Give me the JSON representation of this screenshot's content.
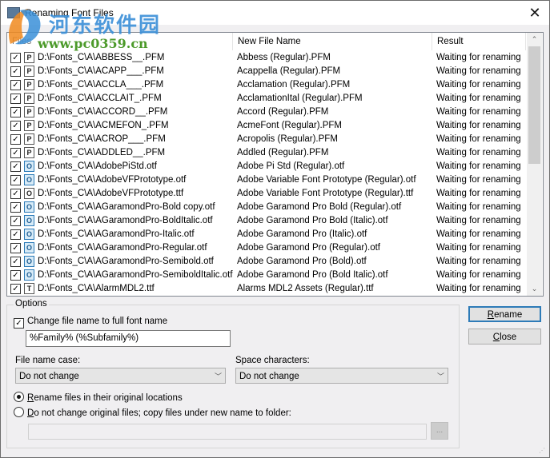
{
  "window": {
    "title": "Renaming Font Files",
    "close_glyph": "✕",
    "title_icon": "app-icon"
  },
  "watermark": {
    "text_cn": "河东软件园",
    "url": "www.pc0359.cn"
  },
  "list": {
    "columns": [
      "Files",
      "New File Name",
      "Result"
    ],
    "rows": [
      {
        "checked": true,
        "type": "P",
        "type_class": "pfm",
        "file": "D:\\Fonts_C\\A\\ABBESS__.PFM",
        "new_name": "Abbess (Regular).PFM",
        "result": "Waiting for renaming"
      },
      {
        "checked": true,
        "type": "P",
        "type_class": "pfm",
        "file": "D:\\Fonts_C\\A\\ACAPP___.PFM",
        "new_name": "Acappella (Regular).PFM",
        "result": "Waiting for renaming"
      },
      {
        "checked": true,
        "type": "P",
        "type_class": "pfm",
        "file": "D:\\Fonts_C\\A\\ACCLA___.PFM",
        "new_name": "Acclamation (Regular).PFM",
        "result": "Waiting for renaming"
      },
      {
        "checked": true,
        "type": "P",
        "type_class": "pfm",
        "file": "D:\\Fonts_C\\A\\ACCLAIT_.PFM",
        "new_name": "AcclamationItal (Regular).PFM",
        "result": "Waiting for renaming"
      },
      {
        "checked": true,
        "type": "P",
        "type_class": "pfm",
        "file": "D:\\Fonts_C\\A\\ACCORD__.PFM",
        "new_name": "Accord (Regular).PFM",
        "result": "Waiting for renaming"
      },
      {
        "checked": true,
        "type": "P",
        "type_class": "pfm",
        "file": "D:\\Fonts_C\\A\\ACMEFON_.PFM",
        "new_name": "AcmeFont (Regular).PFM",
        "result": "Waiting for renaming"
      },
      {
        "checked": true,
        "type": "P",
        "type_class": "pfm",
        "file": "D:\\Fonts_C\\A\\ACROP___.PFM",
        "new_name": "Acropolis (Regular).PFM",
        "result": "Waiting for renaming"
      },
      {
        "checked": true,
        "type": "P",
        "type_class": "pfm",
        "file": "D:\\Fonts_C\\A\\ADDLED__.PFM",
        "new_name": "Addled (Regular).PFM",
        "result": "Waiting for renaming"
      },
      {
        "checked": true,
        "type": "O",
        "type_class": "otf",
        "file": "D:\\Fonts_C\\A\\AdobePiStd.otf",
        "new_name": "Adobe Pi Std (Regular).otf",
        "result": "Waiting for renaming"
      },
      {
        "checked": true,
        "type": "O",
        "type_class": "otf",
        "file": "D:\\Fonts_C\\A\\AdobeVFPrototype.otf",
        "new_name": "Adobe Variable Font Prototype (Regular).otf",
        "result": "Waiting for renaming"
      },
      {
        "checked": true,
        "type": "O",
        "type_class": "ottf",
        "file": "D:\\Fonts_C\\A\\AdobeVFPrototype.ttf",
        "new_name": "Adobe Variable Font Prototype (Regular).ttf",
        "result": "Waiting for renaming"
      },
      {
        "checked": true,
        "type": "O",
        "type_class": "otf",
        "file": "D:\\Fonts_C\\A\\AGaramondPro-Bold copy.otf",
        "new_name": "Adobe Garamond Pro Bold (Regular).otf",
        "result": "Waiting for renaming"
      },
      {
        "checked": true,
        "type": "O",
        "type_class": "otf",
        "file": "D:\\Fonts_C\\A\\AGaramondPro-BoldItalic.otf",
        "new_name": "Adobe Garamond Pro Bold (Italic).otf",
        "result": "Waiting for renaming"
      },
      {
        "checked": true,
        "type": "O",
        "type_class": "otf",
        "file": "D:\\Fonts_C\\A\\AGaramondPro-Italic.otf",
        "new_name": "Adobe Garamond Pro (Italic).otf",
        "result": "Waiting for renaming"
      },
      {
        "checked": true,
        "type": "O",
        "type_class": "otf",
        "file": "D:\\Fonts_C\\A\\AGaramondPro-Regular.otf",
        "new_name": "Adobe Garamond Pro (Regular).otf",
        "result": "Waiting for renaming"
      },
      {
        "checked": true,
        "type": "O",
        "type_class": "otf",
        "file": "D:\\Fonts_C\\A\\AGaramondPro-Semibold.otf",
        "new_name": "Adobe Garamond Pro (Bold).otf",
        "result": "Waiting for renaming"
      },
      {
        "checked": true,
        "type": "O",
        "type_class": "otf",
        "file": "D:\\Fonts_C\\A\\AGaramondPro-SemiboldItalic.otf",
        "new_name": "Adobe Garamond Pro (Bold Italic).otf",
        "result": "Waiting for renaming"
      },
      {
        "checked": true,
        "type": "T",
        "type_class": "ttf",
        "file": "D:\\Fonts_C\\A\\AlarmMDL2.ttf",
        "new_name": "Alarms MDL2 Assets (Regular).ttf",
        "result": "Waiting for renaming"
      }
    ],
    "scroll": {
      "up_glyph": "⌃",
      "down_glyph": "⌄"
    }
  },
  "options": {
    "group_label": "Options",
    "change_name_checkbox": {
      "label": "Change file name to full font name",
      "checked": true
    },
    "pattern_value": "%Family% (%Subfamily%)",
    "file_name_case": {
      "label": "File name case:",
      "value": "Do not change"
    },
    "space_characters": {
      "label": "Space characters:",
      "value": "Do not change"
    },
    "radio_rename_in_place": {
      "label_access": "R",
      "label_rest": "ename files in their original locations",
      "selected": true
    },
    "radio_copy_to_folder": {
      "label_access": "D",
      "label_rest": "o not change original files; copy files under new name to folder:",
      "selected": false
    },
    "folder_value": "",
    "browse_label": "..."
  },
  "buttons": {
    "rename": {
      "access": "R",
      "rest": "ename"
    },
    "close": {
      "access": "C",
      "rest": "lose"
    }
  }
}
